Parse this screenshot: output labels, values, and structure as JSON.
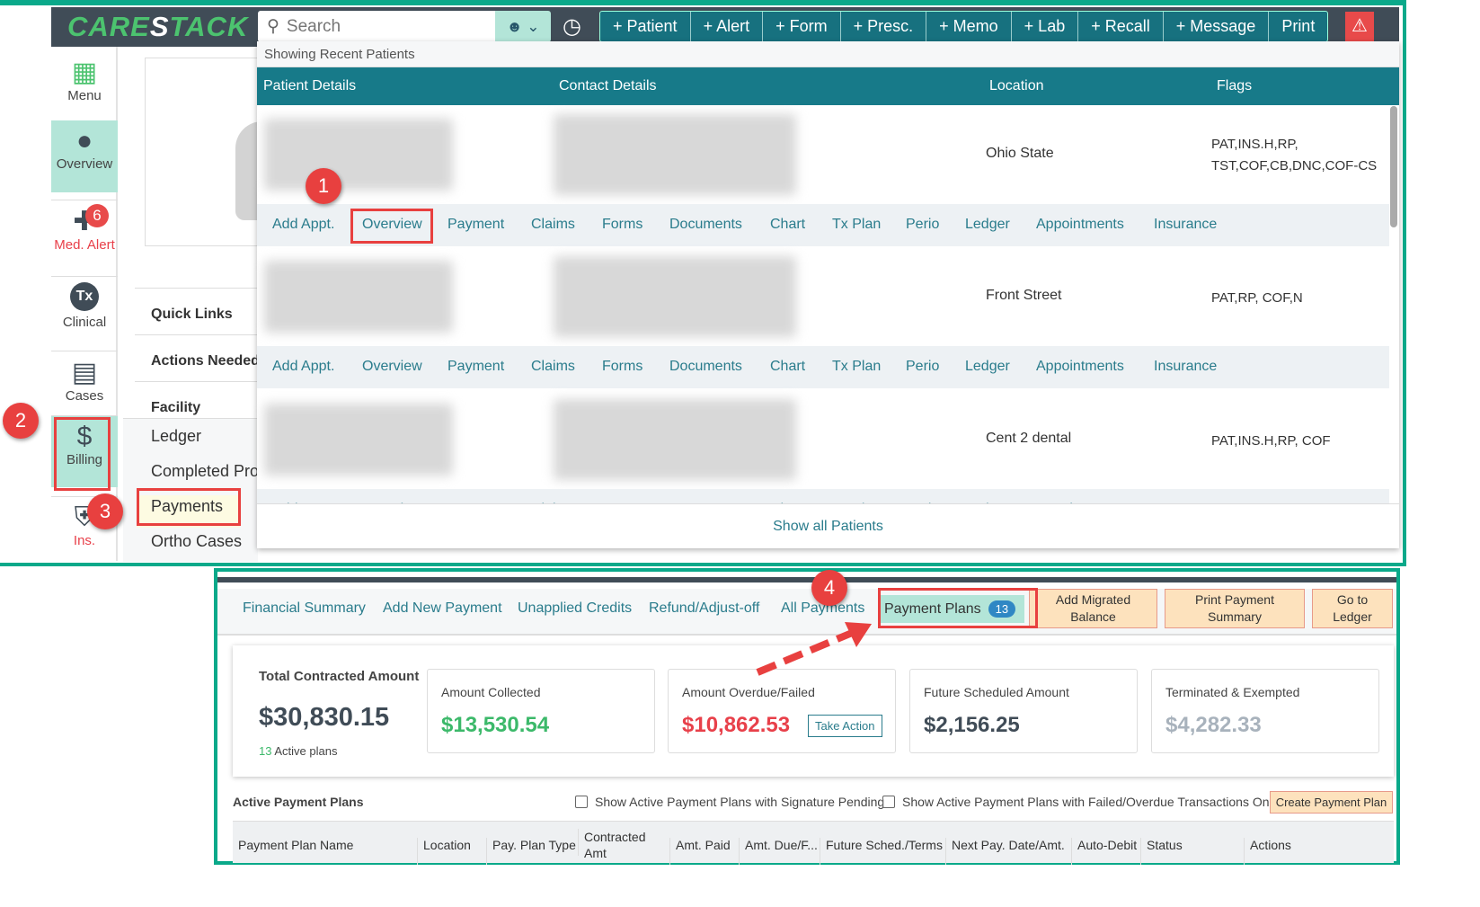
{
  "header": {
    "logo": "CARESTACK",
    "search_placeholder": "Search",
    "toolbar": [
      "+ Patient",
      "+ Alert",
      "+ Form",
      "+ Presc.",
      "+ Memo",
      "+ Lab",
      "+ Recall",
      "+ Message",
      "Print"
    ]
  },
  "sidebar": [
    {
      "label": "Menu",
      "icon": "grid-icon"
    },
    {
      "label": "Overview",
      "icon": "user-icon"
    },
    {
      "label": "Med. Alert",
      "icon": "medical-cross-icon",
      "badge": "6"
    },
    {
      "label": "Clinical",
      "icon": "tx-icon"
    },
    {
      "label": "Cases",
      "icon": "case-icon"
    },
    {
      "label": "Billing",
      "icon": "bill-icon"
    },
    {
      "label": "Ins.",
      "icon": "shield-icon"
    }
  ],
  "middle": {
    "sections": [
      "Quick Links",
      "Actions Needed",
      "Facility"
    ],
    "billing_menu": [
      "Ledger",
      "Completed Pro",
      "Payments",
      "Ortho Cases"
    ]
  },
  "dropdown": {
    "subtitle": "Showing Recent Patients",
    "columns": [
      "Patient Details",
      "Contact Details",
      "Location",
      "Flags"
    ],
    "patients": [
      {
        "location": "Ohio State",
        "flags": "PAT,INS.H,RP,\nTST,COF,CB,DNC,COF-CS"
      },
      {
        "location": "Front Street",
        "flags": "PAT,RP, COF,N"
      },
      {
        "location": "Cent 2 dental",
        "flags": "PAT,INS.H,RP, COF"
      }
    ],
    "actions": [
      "Add Appt.",
      "Overview",
      "Payment",
      "Claims",
      "Forms",
      "Documents",
      "Chart",
      "Tx Plan",
      "Perio",
      "Ledger",
      "Appointments",
      "Insurance"
    ],
    "show_all": "Show all Patients"
  },
  "callouts": [
    "1",
    "2",
    "3",
    "4"
  ],
  "payments": {
    "tabs": [
      "Financial Summary",
      "Add New Payment",
      "Unapplied Credits",
      "Refund/Adjust-off",
      "All Payments",
      "Payment Plans"
    ],
    "payment_plans_count": "13",
    "buttons": [
      "Add Migrated\nBalance",
      "Print Payment\nSummary",
      "Go to\nLedger"
    ],
    "total": {
      "label": "Total Contracted Amount",
      "value": "$30,830.15",
      "active_count": "13",
      "active_label": "Active plans"
    },
    "cards": [
      {
        "label": "Amount Collected",
        "value": "$13,530.54",
        "color": "#3cb96a"
      },
      {
        "label": "Amount Overdue/Failed",
        "value": "$10,862.53",
        "color": "#e8404a",
        "action": "Take Action"
      },
      {
        "label": "Future Scheduled Amount",
        "value": "$2,156.25",
        "color": "#404c57"
      },
      {
        "label": "Terminated & Exempted",
        "value": "$4,282.33",
        "color": "#a8b2bc"
      }
    ],
    "active_title": "Active Payment Plans",
    "checkboxes": [
      "Show Active Payment Plans with Signature Pending",
      "Show Active Payment Plans with Failed/Overdue Transactions Only"
    ],
    "create_button": "Create Payment Plan",
    "columns": [
      "Payment Plan Name",
      "Location",
      "Pay. Plan Type",
      "Contracted Amt",
      "Amt. Paid",
      "Amt. Due/F...",
      "Future Sched./Terms",
      "Next Pay. Date/Amt.",
      "Auto-Debit",
      "Status",
      "Actions"
    ]
  }
}
